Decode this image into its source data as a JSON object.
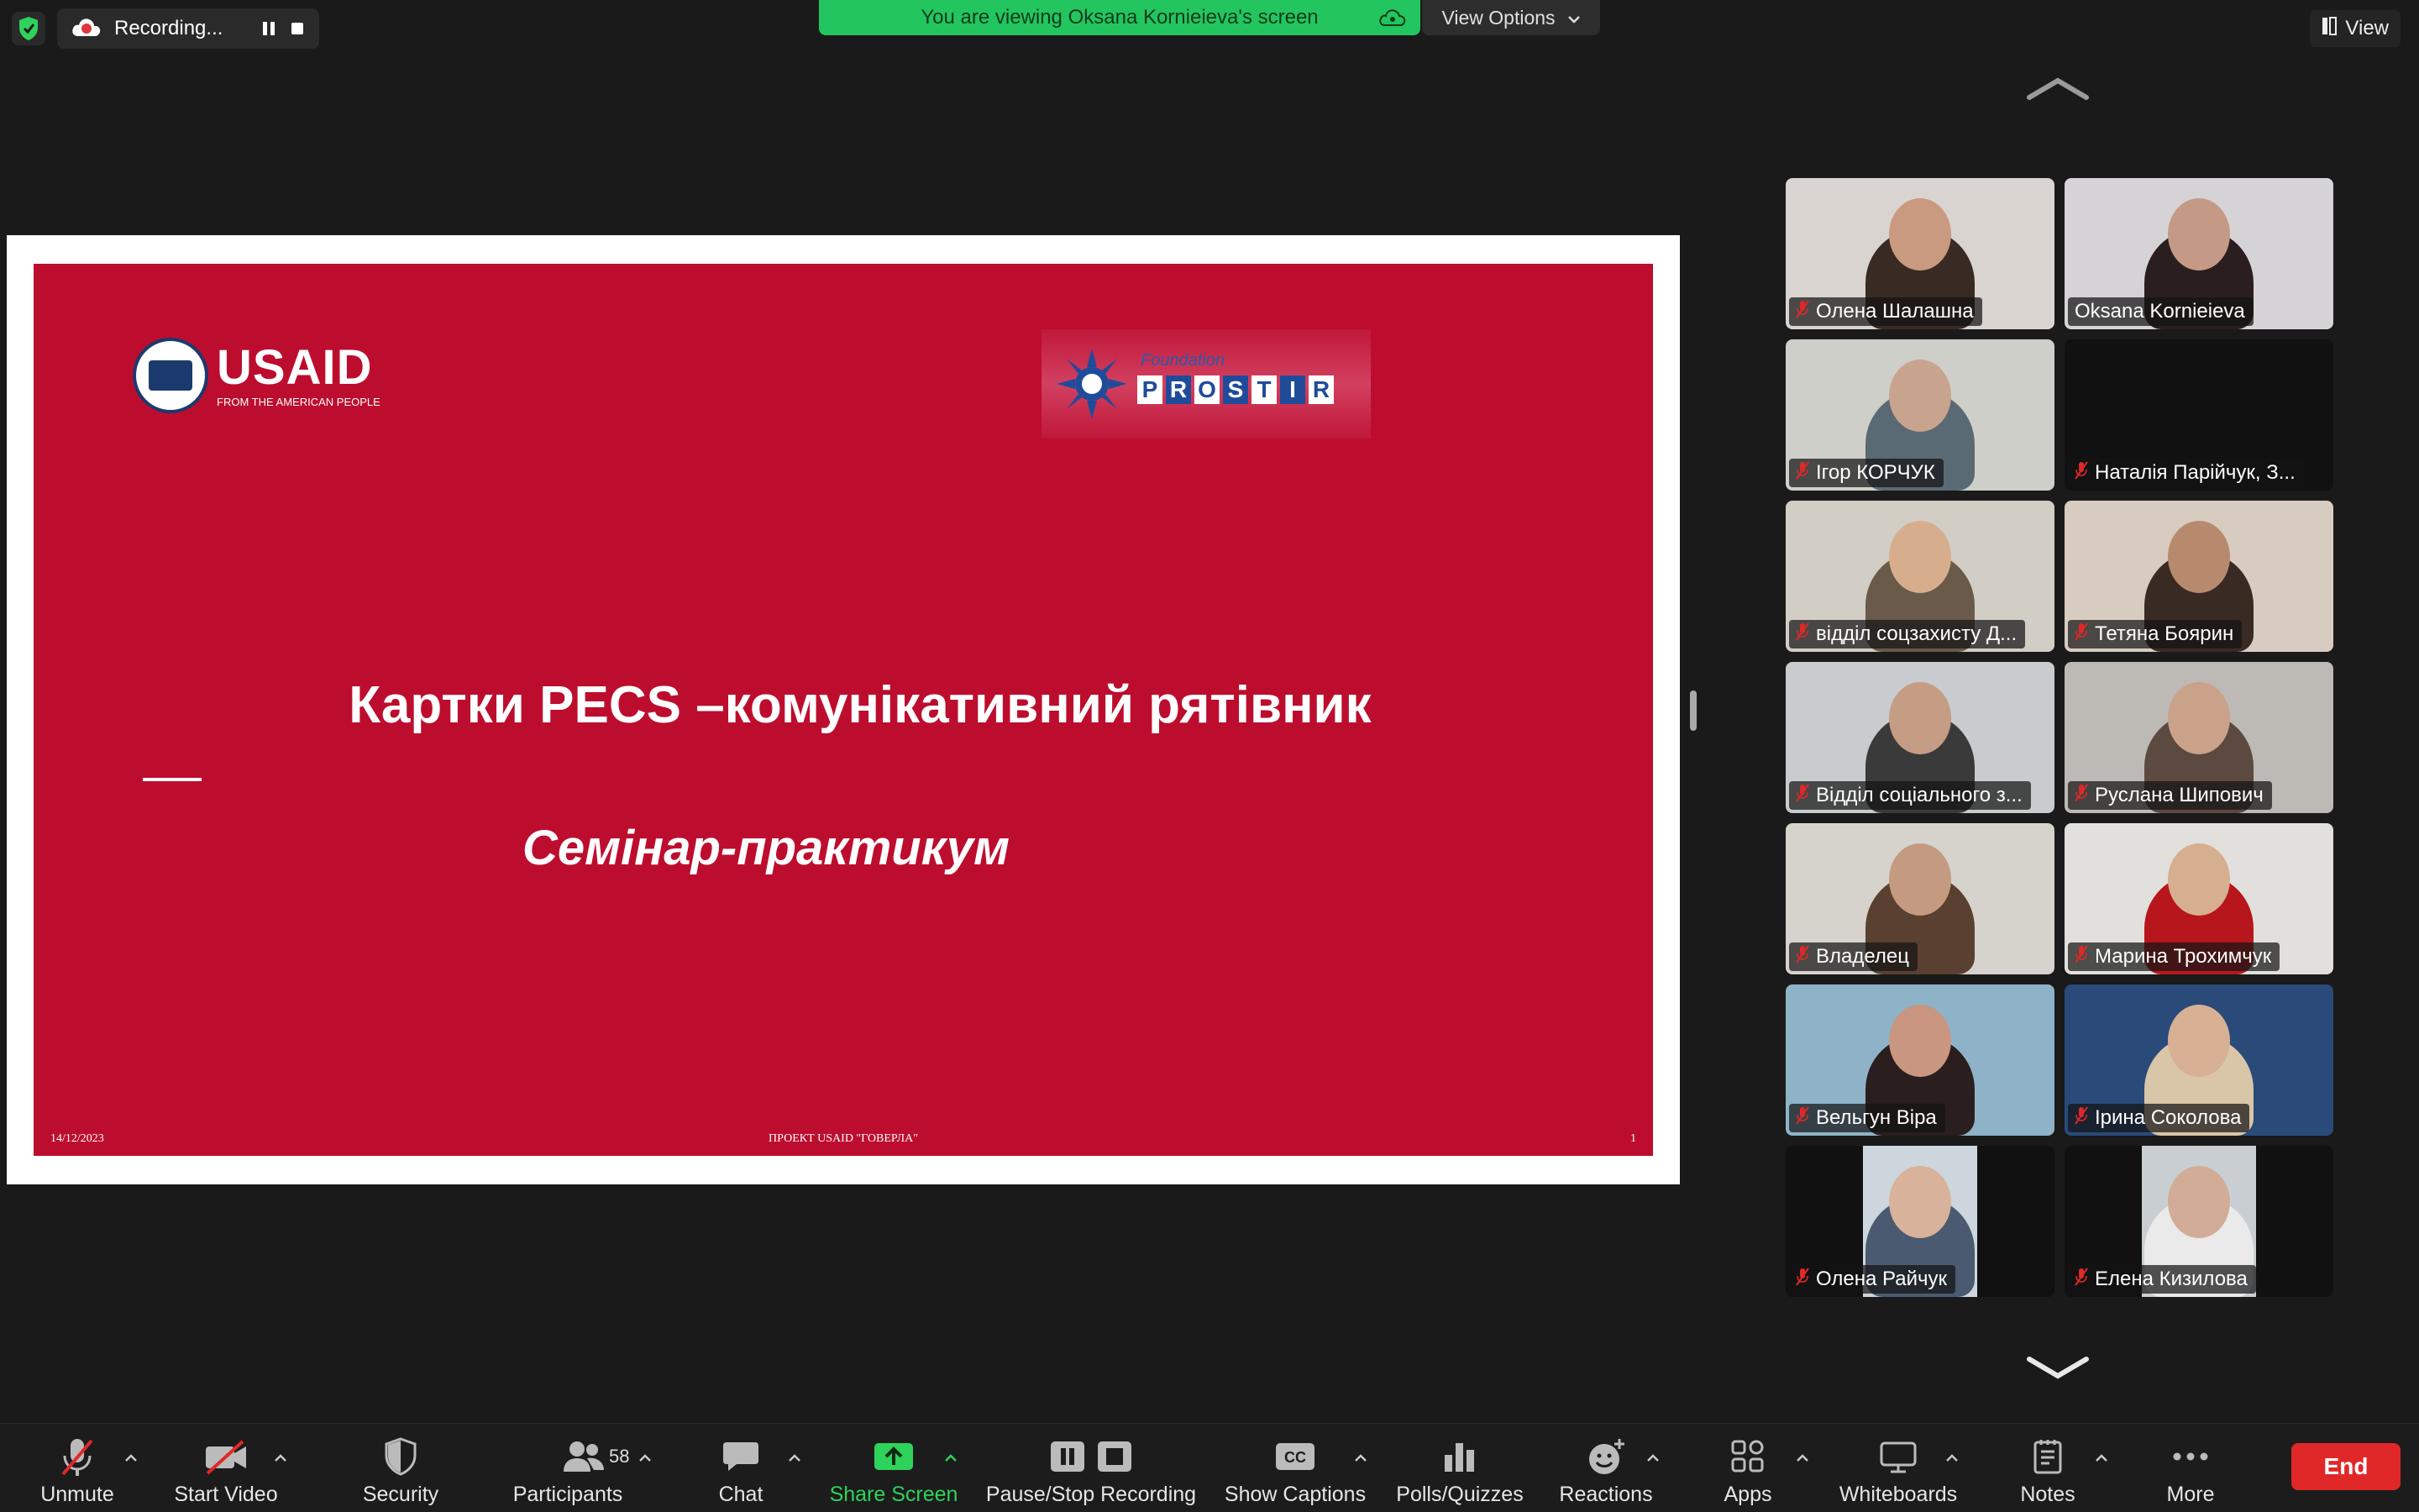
{
  "topbar": {
    "recording_label": "Recording...",
    "banner_text": "You are viewing Oksana Kornieieva's screen",
    "view_options_label": "View Options",
    "view_label": "View"
  },
  "slide": {
    "title": "Картки PECS –комунікативний рятівник",
    "subtitle": "Семінар-практикум",
    "footer_date": "14/12/2023",
    "footer_project": "ПРОЕКТ USAID \"ГОВЕРЛА\"",
    "footer_page": "1",
    "usaid_word": "USAID",
    "usaid_tagline": "FROM THE AMERICAN PEOPLE",
    "prostir_foundation": "Foundation",
    "prostir_letters": [
      "P",
      "R",
      "O",
      "S",
      "T",
      "I",
      "R"
    ]
  },
  "participants": [
    {
      "name": "Олена Шалашна"
    },
    {
      "name": "Oksana Kornieieva",
      "active": true
    },
    {
      "name": "Ігор КОРЧУК"
    },
    {
      "name": "Наталія Парійчук, З..."
    },
    {
      "name": "відділ соцзахисту Д..."
    },
    {
      "name": "Тетяна Боярин"
    },
    {
      "name": "Відділ соціального з..."
    },
    {
      "name": "Руслана Шипович"
    },
    {
      "name": "Владелец"
    },
    {
      "name": "Марина Трохимчук"
    },
    {
      "name": "Вельгун Віра"
    },
    {
      "name": "Ірина Соколова"
    },
    {
      "name": "Олена Райчук"
    },
    {
      "name": "Елена Кизилова"
    }
  ],
  "toolbar": {
    "unmute": "Unmute",
    "start_video": "Start Video",
    "security": "Security",
    "participants": "Participants",
    "participants_count": "58",
    "chat": "Chat",
    "share_screen": "Share Screen",
    "pause_stop_recording": "Pause/Stop Recording",
    "show_captions": "Show Captions",
    "polls": "Polls/Quizzes",
    "reactions": "Reactions",
    "apps": "Apps",
    "whiteboards": "Whiteboards",
    "notes": "Notes",
    "more": "More",
    "end": "End"
  },
  "colors": {
    "slide_red": "#bd0d2e",
    "zoom_green": "#23c55e",
    "end_red": "#e02828",
    "active_speaker": "#2fd25b"
  }
}
